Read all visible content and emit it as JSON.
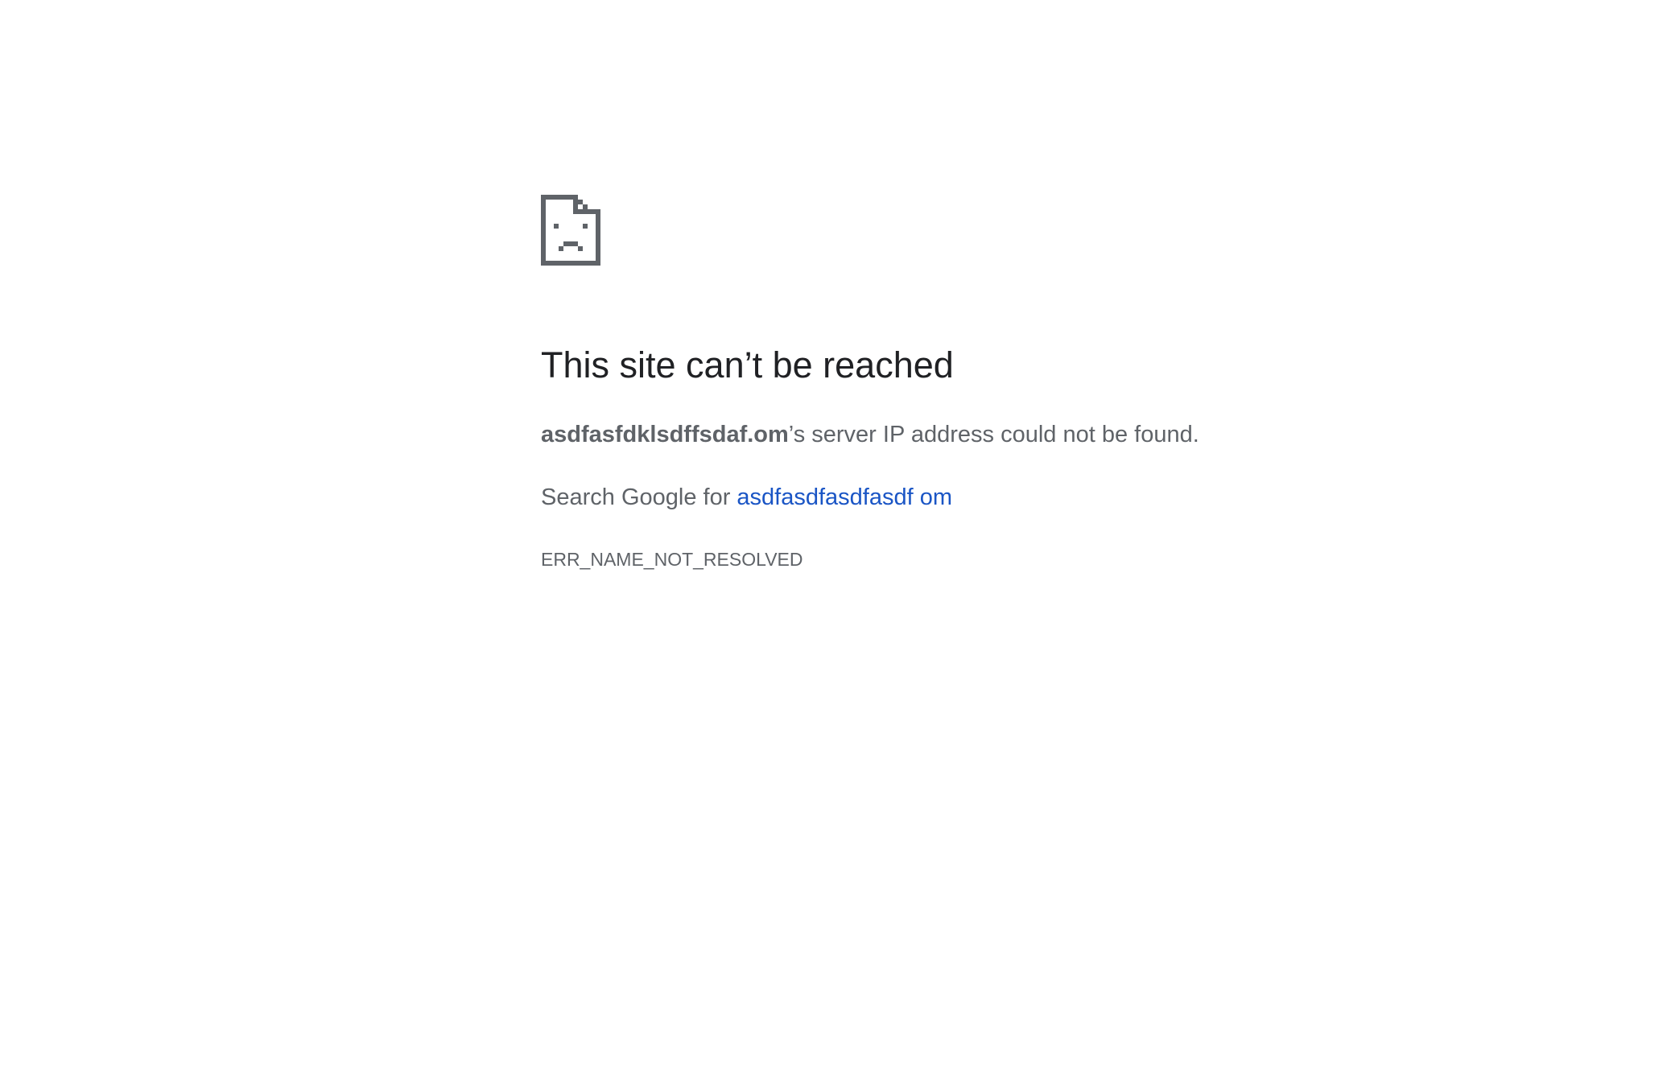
{
  "page": {
    "icon": "sad-document-icon",
    "title": "This site can’t be reached",
    "error": {
      "host": "asdfasfdklsdffsdaf.om",
      "suffix": "’s server IP address could not be found."
    },
    "suggestion": {
      "prefix": "Search Google for ",
      "link_text": "asdfasdfasdfasdf om"
    },
    "error_code": "ERR_NAME_NOT_RESOLVED"
  },
  "colors": {
    "title": "#202124",
    "body_text": "#5f6368",
    "link": "#1a55c5",
    "icon": "#5f6368",
    "background": "#ffffff"
  }
}
